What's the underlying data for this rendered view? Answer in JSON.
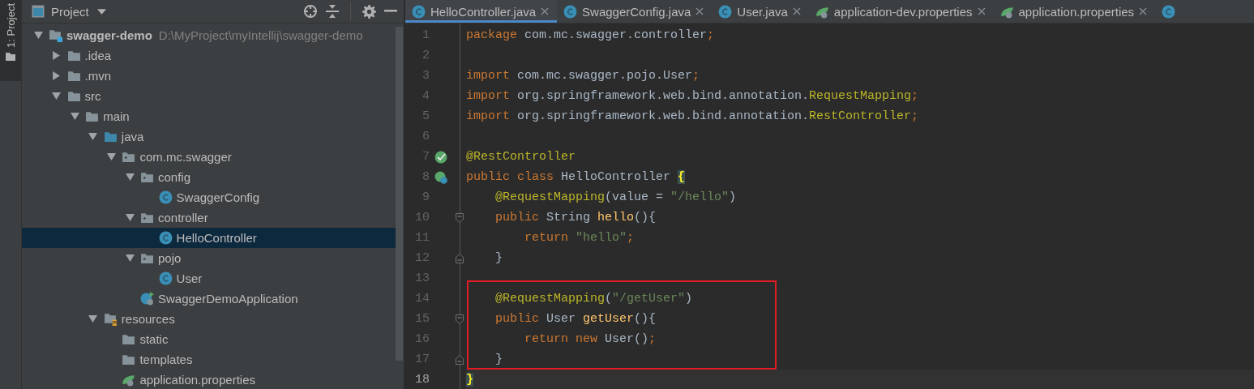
{
  "tool_strip": {
    "label": "1: Project",
    "selected": true
  },
  "project_panel": {
    "title": "Project"
  },
  "tree": [
    {
      "label": "swagger-demo",
      "path": "D:\\MyProject\\myIntellij\\swagger-demo",
      "kind": "module",
      "expanded": true,
      "selected": false,
      "children": [
        {
          "label": ".idea",
          "kind": "folder",
          "expanded": false,
          "selected": false
        },
        {
          "label": ".mvn",
          "kind": "folder",
          "expanded": false,
          "selected": false
        },
        {
          "label": "src",
          "kind": "folder",
          "expanded": true,
          "selected": false,
          "children": [
            {
              "label": "main",
              "kind": "folder",
              "expanded": true,
              "selected": false,
              "children": [
                {
                  "label": "java",
                  "kind": "source",
                  "expanded": true,
                  "selected": false,
                  "children": [
                    {
                      "label": "com.mc.swagger",
                      "kind": "package",
                      "expanded": true,
                      "selected": false,
                      "children": [
                        {
                          "label": "config",
                          "kind": "package",
                          "expanded": true,
                          "selected": false,
                          "children": [
                            {
                              "label": "SwaggerConfig",
                              "kind": "class",
                              "selected": false
                            }
                          ]
                        },
                        {
                          "label": "controller",
                          "kind": "package",
                          "expanded": true,
                          "selected": false,
                          "children": [
                            {
                              "label": "HelloController",
                              "kind": "class",
                              "selected": true
                            }
                          ]
                        },
                        {
                          "label": "pojo",
                          "kind": "package",
                          "expanded": true,
                          "selected": false,
                          "children": [
                            {
                              "label": "User",
                              "kind": "class",
                              "selected": false
                            }
                          ]
                        },
                        {
                          "label": "SwaggerDemoApplication",
                          "kind": "application",
                          "selected": false
                        }
                      ]
                    }
                  ]
                },
                {
                  "label": "resources",
                  "kind": "resources",
                  "expanded": true,
                  "selected": false,
                  "children": [
                    {
                      "label": "static",
                      "kind": "folder",
                      "selected": false
                    },
                    {
                      "label": "templates",
                      "kind": "folder",
                      "selected": false
                    },
                    {
                      "label": "application.properties",
                      "kind": "properties",
                      "selected": false
                    }
                  ]
                }
              ]
            }
          ]
        }
      ]
    }
  ],
  "tabs": [
    {
      "label": "HelloController.java",
      "kind": "class",
      "selected": true
    },
    {
      "label": "SwaggerConfig.java",
      "kind": "class",
      "selected": false
    },
    {
      "label": "User.java",
      "kind": "class",
      "selected": false
    },
    {
      "label": "application-dev.properties",
      "kind": "properties",
      "selected": false
    },
    {
      "label": "application.properties",
      "kind": "properties",
      "selected": false
    },
    {
      "kind": "class",
      "selected": false
    }
  ],
  "code_sections": [
    {
      "boxed": false,
      "lines": [
        {
          "number": "1",
          "kind": "plain",
          "current": false,
          "tokens": [
            {
              "kind": "keyword",
              "text": "package "
            },
            {
              "kind": "plain",
              "text": "com.mc.swagger.controller"
            },
            {
              "kind": "keyword",
              "text": ";"
            }
          ]
        },
        {
          "number": "2",
          "kind": "plain",
          "current": false
        },
        {
          "number": "3",
          "kind": "plain",
          "current": false,
          "tokens": [
            {
              "kind": "keyword",
              "text": "import "
            },
            {
              "kind": "plain",
              "text": "com.mc.swagger.pojo.User"
            },
            {
              "kind": "keyword",
              "text": ";"
            }
          ]
        },
        {
          "number": "4",
          "kind": "plain",
          "current": false,
          "tokens": [
            {
              "kind": "keyword",
              "text": "import "
            },
            {
              "kind": "plain",
              "text": "org.springframework.web.bind.annotation."
            },
            {
              "kind": "annotation",
              "text": "RequestMapping"
            },
            {
              "kind": "keyword",
              "text": ";"
            }
          ]
        },
        {
          "number": "5",
          "kind": "plain",
          "current": false,
          "tokens": [
            {
              "kind": "keyword",
              "text": "import "
            },
            {
              "kind": "plain",
              "text": "org.springframework.web.bind.annotation."
            },
            {
              "kind": "annotation",
              "text": "RestController"
            },
            {
              "kind": "keyword",
              "text": ";"
            }
          ]
        },
        {
          "number": "6",
          "kind": "plain",
          "current": false
        },
        {
          "number": "7",
          "kind": "bean",
          "current": false,
          "tokens": [
            {
              "kind": "annotation",
              "text": "@RestController"
            }
          ]
        },
        {
          "number": "8",
          "kind": "class-bean",
          "current": false,
          "tokens": [
            {
              "kind": "keyword",
              "text": "public class "
            },
            {
              "kind": "plain",
              "text": "HelloController "
            },
            {
              "kind": "brace-match",
              "text": "{"
            }
          ]
        },
        {
          "number": "9",
          "kind": "plain",
          "current": false,
          "tokens": [
            {
              "kind": "annotation",
              "text": "    @RequestMapping"
            },
            {
              "kind": "plain",
              "text": "(value = "
            },
            {
              "kind": "string",
              "text": "\"/hello\""
            },
            {
              "kind": "plain",
              "text": ")"
            }
          ]
        },
        {
          "number": "10",
          "kind": "fold-start",
          "current": false,
          "tokens": [
            {
              "kind": "keyword",
              "text": "    public "
            },
            {
              "kind": "plain",
              "text": "String "
            },
            {
              "kind": "method",
              "text": "hello"
            },
            {
              "kind": "plain",
              "text": "(){"
            }
          ]
        },
        {
          "number": "11",
          "kind": "plain",
          "current": false,
          "tokens": [
            {
              "kind": "keyword",
              "text": "        return "
            },
            {
              "kind": "string",
              "text": "\"hello\""
            },
            {
              "kind": "keyword",
              "text": ";"
            }
          ]
        },
        {
          "number": "12",
          "kind": "fold-end",
          "current": false,
          "tokens": [
            {
              "kind": "plain",
              "text": "    }"
            }
          ]
        },
        {
          "number": "13",
          "kind": "plain",
          "current": false
        }
      ]
    },
    {
      "boxed": true,
      "lines": [
        {
          "number": "14",
          "kind": "plain",
          "current": false,
          "tokens": [
            {
              "kind": "annotation",
              "text": "    @RequestMapping"
            },
            {
              "kind": "plain",
              "text": "("
            },
            {
              "kind": "string",
              "text": "\"/getUser\""
            },
            {
              "kind": "plain",
              "text": ")"
            }
          ]
        },
        {
          "number": "15",
          "kind": "fold-start",
          "current": false,
          "tokens": [
            {
              "kind": "keyword",
              "text": "    public "
            },
            {
              "kind": "plain",
              "text": "User "
            },
            {
              "kind": "method",
              "text": "getUser"
            },
            {
              "kind": "plain",
              "text": "(){"
            }
          ]
        },
        {
          "number": "16",
          "kind": "plain",
          "current": false,
          "tokens": [
            {
              "kind": "keyword",
              "text": "        return new "
            },
            {
              "kind": "plain",
              "text": "User()"
            },
            {
              "kind": "keyword",
              "text": ";"
            }
          ]
        },
        {
          "number": "17",
          "kind": "fold-end",
          "current": false,
          "tokens": [
            {
              "kind": "plain",
              "text": "    }"
            }
          ]
        }
      ]
    },
    {
      "boxed": false,
      "lines": [
        {
          "number": "18",
          "kind": "plain",
          "current": true,
          "tokens": [
            {
              "kind": "brace-match",
              "text": "}"
            }
          ]
        }
      ]
    }
  ]
}
